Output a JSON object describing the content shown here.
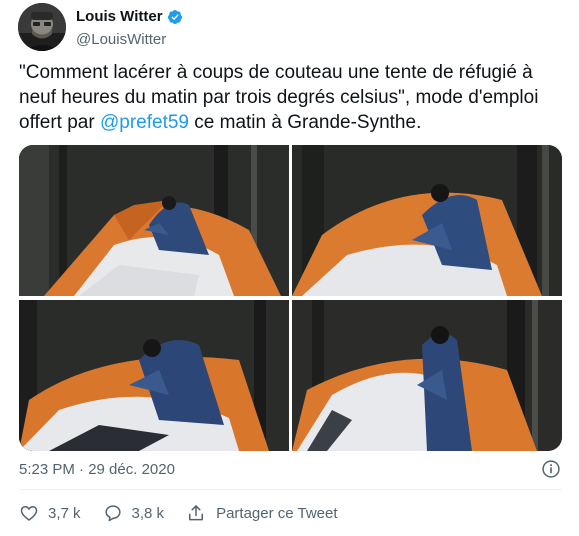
{
  "author": {
    "name": "Louis Witter",
    "handle": "@LouisWitter"
  },
  "tweet": {
    "text_part1": "\"Comment lacérer à coups de couteau une tente de réfugié à neuf heures du matin par trois degrés celsius\", mode d'emploi offert par ",
    "mention": "@prefet59",
    "text_part2": " ce matin à Grande-Synthe."
  },
  "timestamp": "5:23 PM · 29 déc. 2020",
  "actions": {
    "likes": "3,7 k",
    "replies": "3,8 k",
    "share": "Partager ce Tweet"
  },
  "icons": {
    "verified": "verified-badge-icon",
    "info": "info-icon",
    "like": "heart-icon",
    "reply": "speech-bubble-icon",
    "share": "share-icon"
  },
  "colors": {
    "accent": "#1d9bf0",
    "text": "#0f1419",
    "secondary": "#536471",
    "tent": "#e07a2c"
  }
}
